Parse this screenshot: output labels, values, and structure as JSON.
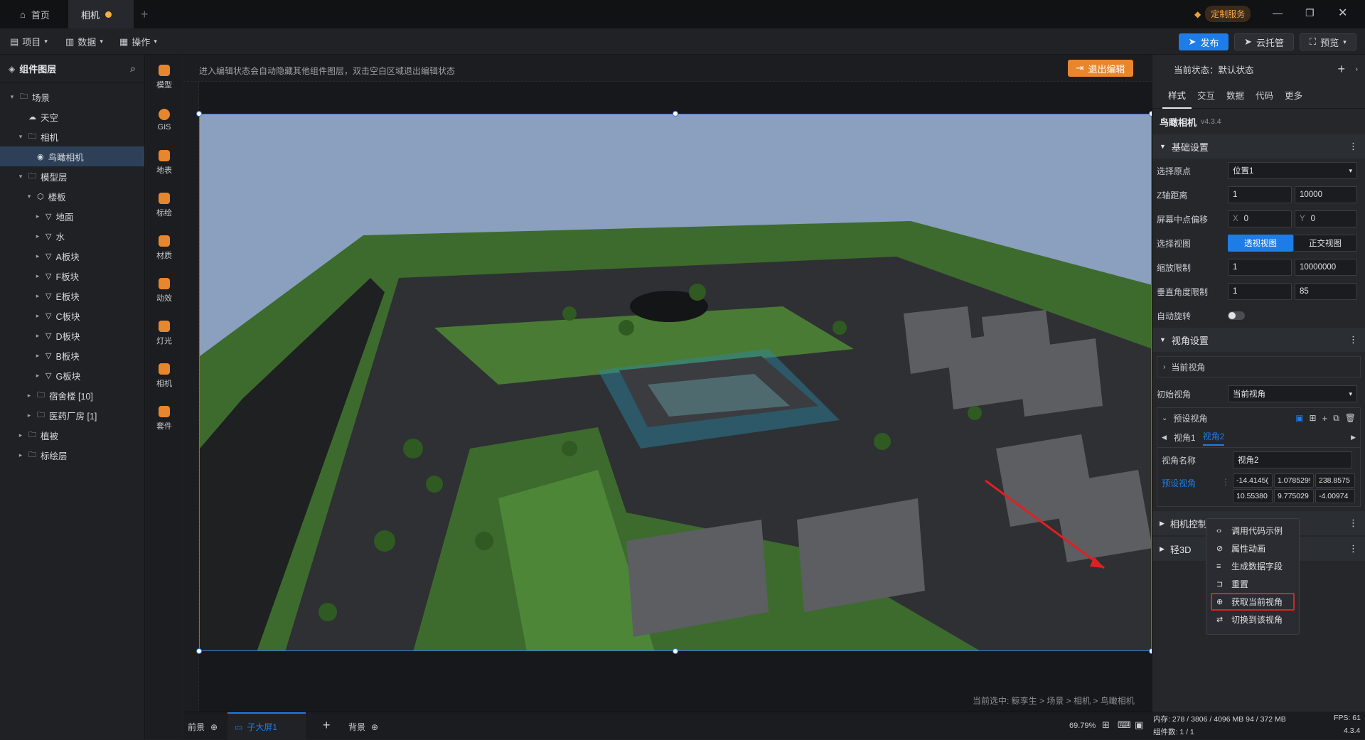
{
  "titlebar": {
    "home_tab": "首页",
    "file_tab": "相机",
    "custom_service": "定制服务"
  },
  "menubar": {
    "project": "项目",
    "data": "数据",
    "operate": "操作",
    "publish": "发布",
    "cloud": "云托管",
    "preview": "预览"
  },
  "layers": {
    "title": "组件图层",
    "items": [
      {
        "label": "场景",
        "depth": 0,
        "caret": "▾",
        "icon": "folder-icon"
      },
      {
        "label": "天空",
        "depth": 1,
        "caret": "",
        "icon": "sky-icon"
      },
      {
        "label": "相机",
        "depth": 1,
        "caret": "▾",
        "icon": "folder-icon"
      },
      {
        "label": "鸟瞰相机",
        "depth": 2,
        "caret": "",
        "icon": "camera-icon",
        "selected": true
      },
      {
        "label": "模型层",
        "depth": 1,
        "caret": "▾",
        "icon": "folder-icon"
      },
      {
        "label": "楼板",
        "depth": 2,
        "caret": "▾",
        "icon": "cube-icon"
      },
      {
        "label": "地面",
        "depth": 3,
        "caret": "▸",
        "icon": "triangle-icon"
      },
      {
        "label": "水",
        "depth": 3,
        "caret": "▸",
        "icon": "triangle-icon"
      },
      {
        "label": "A板块",
        "depth": 3,
        "caret": "▸",
        "icon": "triangle-icon"
      },
      {
        "label": "F板块",
        "depth": 3,
        "caret": "▸",
        "icon": "triangle-icon"
      },
      {
        "label": "E板块",
        "depth": 3,
        "caret": "▸",
        "icon": "triangle-icon"
      },
      {
        "label": "C板块",
        "depth": 3,
        "caret": "▸",
        "icon": "triangle-icon"
      },
      {
        "label": "D板块",
        "depth": 3,
        "caret": "▸",
        "icon": "triangle-icon"
      },
      {
        "label": "B板块",
        "depth": 3,
        "caret": "▸",
        "icon": "triangle-icon"
      },
      {
        "label": "G板块",
        "depth": 3,
        "caret": "▸",
        "icon": "triangle-icon"
      },
      {
        "label": "宿舍楼 [10]",
        "depth": 2,
        "caret": "▸",
        "icon": "folder-icon"
      },
      {
        "label": "医药厂房 [1]",
        "depth": 2,
        "caret": "▸",
        "icon": "folder-icon"
      },
      {
        "label": "植被",
        "depth": 1,
        "caret": "▸",
        "icon": "folder-icon"
      },
      {
        "label": "标绘层",
        "depth": 1,
        "caret": "▸",
        "icon": "folder-icon"
      }
    ]
  },
  "tools": [
    "模型",
    "GIS",
    "地表",
    "标绘",
    "材质",
    "动效",
    "灯光",
    "相机",
    "套件"
  ],
  "stage": {
    "hint": "进入编辑状态会自动隐藏其他组件图层，双击空白区域退出编辑状态",
    "exit_edit": "退出编辑",
    "breadcrumb": "当前选中: 鲸孪生 > 场景 > 相机 > 鸟瞰相机"
  },
  "right": {
    "state": "当前状态：默认状态",
    "tabs": [
      "样式",
      "交互",
      "数据",
      "代码",
      "更多"
    ],
    "component_name": "鸟瞰相机",
    "version": "v4.3.4",
    "basic_title": "基础设置",
    "origin_label": "选择原点",
    "origin_value": "位置1",
    "zdist_label": "Z轴距离",
    "zdist_a": "1",
    "zdist_b": "10000",
    "offset_label": "屏幕中点偏移",
    "offset_x": "0",
    "offset_y": "0",
    "x_tag": "X",
    "y_tag": "Y",
    "view_label": "选择视图",
    "view_persp": "透视视图",
    "view_ortho": "正交视图",
    "zoom_label": "缩放限制",
    "zoom_a": "1",
    "zoom_b": "10000000",
    "vangle_label": "垂直角度限制",
    "vangle_a": "1",
    "vangle_b": "85",
    "autorot_label": "自动旋转",
    "view_settings": "视角设置",
    "current_view": "当前视角",
    "init_view_label": "初始视角",
    "init_view_value": "当前视角",
    "preset_views": "预设视角",
    "view1": "视角1",
    "view2": "视角2",
    "view_name_label": "视角名称",
    "view_name_value": "视角2",
    "preset_label": "预设视角",
    "preset_vals": [
      "-14.4145(",
      "1.078529!",
      "238.8575",
      "10.55380",
      "9.775029",
      "-4.00974"
    ],
    "camera_ctrl": "相机控制",
    "light3d": "轻3D"
  },
  "context_menu": [
    "调用代码示例",
    "属性动画",
    "生成数据字段",
    "重置",
    "获取当前视角",
    "切换到该视角"
  ],
  "bottom": {
    "front": "前景",
    "screen": "子大屏1",
    "back": "背景",
    "zoom": "69.79%"
  },
  "status": {
    "memory": "内存: 278 / 3806 / 4096 MB  94 / 372 MB",
    "fps": "FPS: 61",
    "components": "组件数: 1 / 1",
    "version": "4.3.4"
  },
  "colors": {
    "accent": "#1e7ce8",
    "selection": "#3a7bd5",
    "warning": "#e8862e",
    "highlight": "#e02020"
  }
}
